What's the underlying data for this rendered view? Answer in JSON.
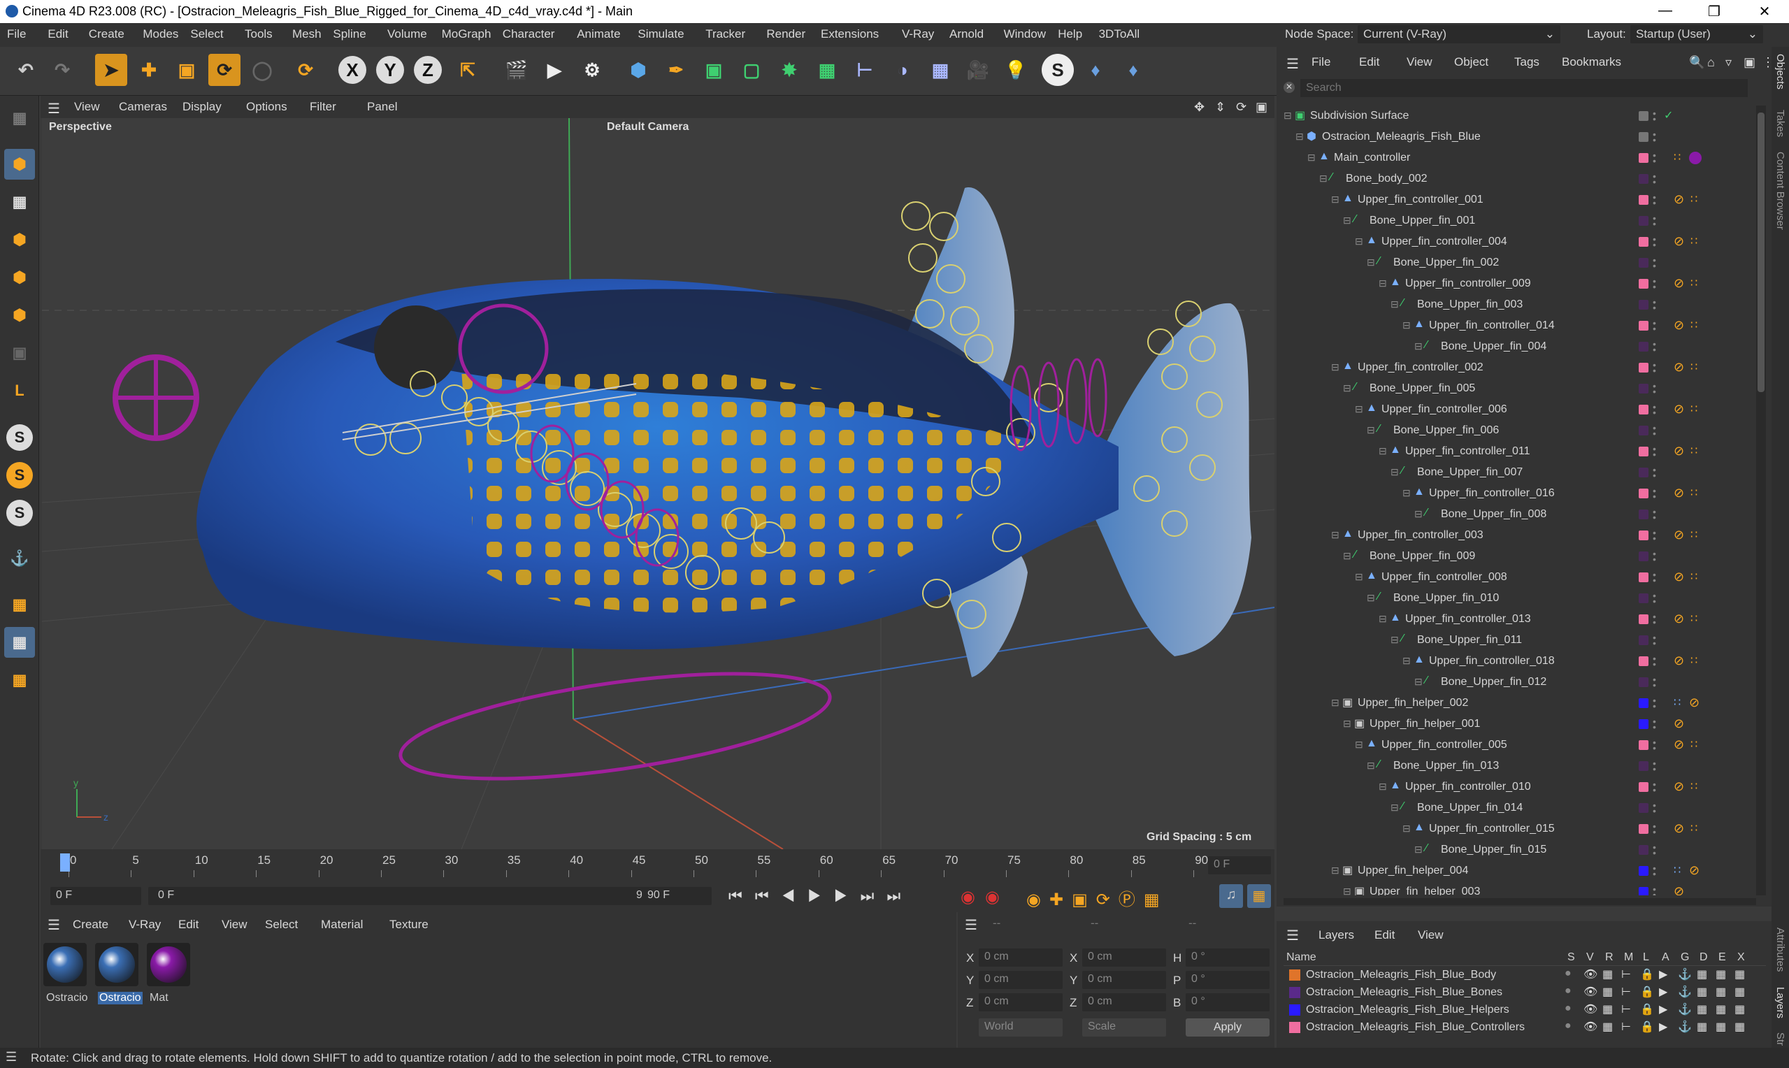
{
  "window": {
    "title": "Cinema 4D R23.008 (RC) - [Ostracion_Meleagris_Fish_Blue_Rigged_for_Cinema_4D_c4d_vray.c4d *] - Main",
    "node_space_label": "Node Space:",
    "node_space_value": "Current (V-Ray)",
    "layout_label": "Layout:",
    "layout_value": "Startup (User)"
  },
  "menu": [
    "File",
    "Edit",
    "Create",
    "Modes",
    "Select",
    "Tools",
    "Mesh",
    "Spline",
    "Volume",
    "MoGraph",
    "Character",
    "Animate",
    "Simulate",
    "Tracker",
    "Render",
    "Extensions",
    "V-Ray",
    "Arnold",
    "Window",
    "Help",
    "3DToAll"
  ],
  "toolbar": {
    "axis_x": "X",
    "axis_y": "Y",
    "axis_z": "Z"
  },
  "viewport": {
    "menu": [
      "View",
      "Cameras",
      "Display",
      "Options",
      "Filter",
      "Panel"
    ],
    "label": "Perspective",
    "camera": "Default Camera",
    "grid_spacing": "Grid Spacing : 5 cm"
  },
  "timeline": {
    "ticks": [
      "0",
      "5",
      "10",
      "15",
      "20",
      "25",
      "30",
      "35",
      "40",
      "45",
      "50",
      "55",
      "60",
      "65",
      "70",
      "75",
      "80",
      "85",
      "90"
    ],
    "current_frame": "0 F",
    "start": "0 F",
    "slider_start": "0 F",
    "slider_end": "90 F",
    "end": "90 F"
  },
  "materials": {
    "menu": [
      "Create",
      "V-Ray",
      "Edit",
      "View",
      "Select",
      "Material",
      "Texture"
    ],
    "items": [
      {
        "label": "Ostracio",
        "color": "#3b6fb5"
      },
      {
        "label": "Ostracio",
        "color": "#3b6fb5"
      },
      {
        "label": "Mat",
        "color": "#8a1aa8"
      }
    ]
  },
  "coords": {
    "x1": "0 cm",
    "y1": "0 cm",
    "z1": "0 cm",
    "x2": "0 cm",
    "y2": "0 cm",
    "z2": "0 cm",
    "h": "0 °",
    "p": "0 °",
    "b": "0 °",
    "lx": "X",
    "ly": "Y",
    "lz": "Z",
    "lx2": "X",
    "ly2": "Y",
    "lz2": "Z",
    "lh": "H",
    "lp": "P",
    "lb": "B",
    "space": "World",
    "mode": "Scale",
    "apply": "Apply",
    "dash1": "--",
    "dash2": "--",
    "dash3": "--"
  },
  "objects": {
    "menu": [
      "File",
      "Edit",
      "View",
      "Object",
      "Tags",
      "Bookmarks"
    ],
    "search_placeholder": "Search",
    "rows": [
      {
        "name": "Subdivision Surface",
        "indent": 0,
        "color": "",
        "type": "subdiv"
      },
      {
        "name": "Ostracion_Meleagris_Fish_Blue",
        "indent": 1,
        "color": "",
        "type": "poly"
      },
      {
        "name": "Main_controller",
        "indent": 2,
        "color": "#f06ea0",
        "type": "null"
      },
      {
        "name": "Bone_body_002",
        "indent": 3,
        "color": "#4a2a5a",
        "type": "bone"
      },
      {
        "name": "Upper_fin_controller_001",
        "indent": 4,
        "color": "#f06ea0",
        "type": "null"
      },
      {
        "name": "Bone_Upper_fin_001",
        "indent": 5,
        "color": "#4a2a5a",
        "type": "bone"
      },
      {
        "name": "Upper_fin_controller_004",
        "indent": 6,
        "color": "#f06ea0",
        "type": "null"
      },
      {
        "name": "Bone_Upper_fin_002",
        "indent": 7,
        "color": "#4a2a5a",
        "type": "bone"
      },
      {
        "name": "Upper_fin_controller_009",
        "indent": 8,
        "color": "#f06ea0",
        "type": "null"
      },
      {
        "name": "Bone_Upper_fin_003",
        "indent": 9,
        "color": "#4a2a5a",
        "type": "bone"
      },
      {
        "name": "Upper_fin_controller_014",
        "indent": 10,
        "color": "#f06ea0",
        "type": "null"
      },
      {
        "name": "Bone_Upper_fin_004",
        "indent": 11,
        "color": "#4a2a5a",
        "type": "bone"
      },
      {
        "name": "Upper_fin_controller_002",
        "indent": 4,
        "color": "#f06ea0",
        "type": "null"
      },
      {
        "name": "Bone_Upper_fin_005",
        "indent": 5,
        "color": "#4a2a5a",
        "type": "bone"
      },
      {
        "name": "Upper_fin_controller_006",
        "indent": 6,
        "color": "#f06ea0",
        "type": "null"
      },
      {
        "name": "Bone_Upper_fin_006",
        "indent": 7,
        "color": "#4a2a5a",
        "type": "bone"
      },
      {
        "name": "Upper_fin_controller_011",
        "indent": 8,
        "color": "#f06ea0",
        "type": "null"
      },
      {
        "name": "Bone_Upper_fin_007",
        "indent": 9,
        "color": "#4a2a5a",
        "type": "bone"
      },
      {
        "name": "Upper_fin_controller_016",
        "indent": 10,
        "color": "#f06ea0",
        "type": "null"
      },
      {
        "name": "Bone_Upper_fin_008",
        "indent": 11,
        "color": "#4a2a5a",
        "type": "bone"
      },
      {
        "name": "Upper_fin_controller_003",
        "indent": 4,
        "color": "#f06ea0",
        "type": "null"
      },
      {
        "name": "Bone_Upper_fin_009",
        "indent": 5,
        "color": "#4a2a5a",
        "type": "bone"
      },
      {
        "name": "Upper_fin_controller_008",
        "indent": 6,
        "color": "#f06ea0",
        "type": "null"
      },
      {
        "name": "Bone_Upper_fin_010",
        "indent": 7,
        "color": "#4a2a5a",
        "type": "bone"
      },
      {
        "name": "Upper_fin_controller_013",
        "indent": 8,
        "color": "#f06ea0",
        "type": "null"
      },
      {
        "name": "Bone_Upper_fin_011",
        "indent": 9,
        "color": "#4a2a5a",
        "type": "bone"
      },
      {
        "name": "Upper_fin_controller_018",
        "indent": 10,
        "color": "#f06ea0",
        "type": "null"
      },
      {
        "name": "Bone_Upper_fin_012",
        "indent": 11,
        "color": "#4a2a5a",
        "type": "bone"
      },
      {
        "name": "Upper_fin_helper_002",
        "indent": 4,
        "color": "#2a1aff",
        "type": "helper"
      },
      {
        "name": "Upper_fin_helper_001",
        "indent": 5,
        "color": "#2a1aff",
        "type": "helper"
      },
      {
        "name": "Upper_fin_controller_005",
        "indent": 6,
        "color": "#f06ea0",
        "type": "null"
      },
      {
        "name": "Bone_Upper_fin_013",
        "indent": 7,
        "color": "#4a2a5a",
        "type": "bone"
      },
      {
        "name": "Upper_fin_controller_010",
        "indent": 8,
        "color": "#f06ea0",
        "type": "null"
      },
      {
        "name": "Bone_Upper_fin_014",
        "indent": 9,
        "color": "#4a2a5a",
        "type": "bone"
      },
      {
        "name": "Upper_fin_controller_015",
        "indent": 10,
        "color": "#f06ea0",
        "type": "null"
      },
      {
        "name": "Bone_Upper_fin_015",
        "indent": 11,
        "color": "#4a2a5a",
        "type": "bone"
      },
      {
        "name": "Upper_fin_helper_004",
        "indent": 4,
        "color": "#2a1aff",
        "type": "helper"
      },
      {
        "name": "Upper_fin_helper_003",
        "indent": 5,
        "color": "#2a1aff",
        "type": "helper"
      }
    ]
  },
  "layers": {
    "menu": [
      "Layers",
      "Edit",
      "View"
    ],
    "header": {
      "name": "Name",
      "cols": [
        "S",
        "V",
        "R",
        "M",
        "L",
        "A",
        "G",
        "D",
        "E",
        "X"
      ]
    },
    "rows": [
      {
        "name": "Ostracion_Meleagris_Fish_Blue_Body",
        "color": "#e0742a"
      },
      {
        "name": "Ostracion_Meleagris_Fish_Blue_Bones",
        "color": "#5a2a8a"
      },
      {
        "name": "Ostracion_Meleagris_Fish_Blue_Helpers",
        "color": "#2a1aff"
      },
      {
        "name": "Ostracion_Meleagris_Fish_Blue_Controllers",
        "color": "#f06ea0"
      }
    ]
  },
  "side_tabs": [
    "Objects",
    "Takes",
    "Content Browser",
    "Attributes",
    "Layers",
    "Str"
  ],
  "status": "Rotate: Click and drag to rotate elements. Hold down SHIFT to add to quantize rotation / add to the selection in point mode, CTRL to remove."
}
